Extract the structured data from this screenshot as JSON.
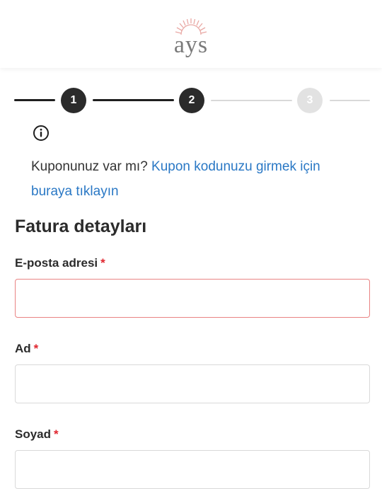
{
  "header": {
    "logo_text": "ays",
    "colors": {
      "sun_rays": "#e9a8a4",
      "logo_text": "#7a7a7a"
    }
  },
  "steps": {
    "items": [
      {
        "label": "1",
        "state": "completed"
      },
      {
        "label": "2",
        "state": "active"
      },
      {
        "label": "3",
        "state": "pending"
      }
    ],
    "colors": {
      "done": "#2b2b2b",
      "pending": "#e2e2e2"
    }
  },
  "coupon": {
    "icon": "info-icon",
    "prompt": "Kuponunuz var mı?",
    "link_text": "Kupon kodunuzu girmek için buraya tıklayın",
    "link_color": "#2a78c5"
  },
  "billing": {
    "title": "Fatura detayları",
    "required_mark": "*",
    "fields": [
      {
        "label": "E-posta adresi",
        "value": "",
        "state": "error"
      },
      {
        "label": "Ad",
        "value": ""
      },
      {
        "label": "Soyad",
        "value": ""
      }
    ],
    "colors": {
      "required": "#e0262f",
      "error_border": "#e98383",
      "border": "#d9d9d9"
    }
  }
}
